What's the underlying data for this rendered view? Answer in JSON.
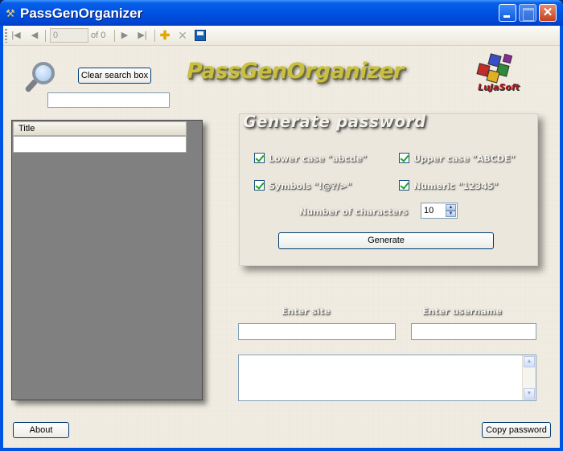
{
  "window": {
    "title": "PassGenOrganizer",
    "close_glyph": "✕"
  },
  "navigator": {
    "position_value": "0",
    "count_label": "of 0",
    "icons": [
      "move-first-icon",
      "move-previous-icon",
      "move-next-icon",
      "move-last-icon",
      "add-new-icon",
      "delete-icon",
      "save-icon"
    ]
  },
  "search": {
    "clear_button": "Clear search box",
    "value": ""
  },
  "logo": {
    "text": "PassGenOrganizer",
    "company": "LuJaSoft"
  },
  "grid": {
    "columns": [
      "Title"
    ],
    "rows": []
  },
  "generator": {
    "title": "Generate password",
    "options": {
      "lower_label": "Lower case \"abcde\"",
      "lower_checked": true,
      "upper_label": "Upper case \"ABCDE\"",
      "upper_checked": true,
      "symbols_label": "Symbols \"!@?/>\"",
      "symbols_checked": true,
      "numeric_label": "Numeric \"12345\"",
      "numeric_checked": true
    },
    "length_label": "Number of characters",
    "length_value": "10",
    "generate_button": "Generate"
  },
  "entry": {
    "site_label": "Enter site",
    "site_value": "",
    "username_label": "Enter username",
    "username_value": "",
    "output_value": ""
  },
  "footer": {
    "about_button": "About",
    "copy_button": "Copy password"
  },
  "colors": {
    "titlebar": "#0055e5",
    "background": "#f1ede2",
    "grid_background": "#808080",
    "logo_text": "#c9c040",
    "check_mark": "#21a121"
  }
}
